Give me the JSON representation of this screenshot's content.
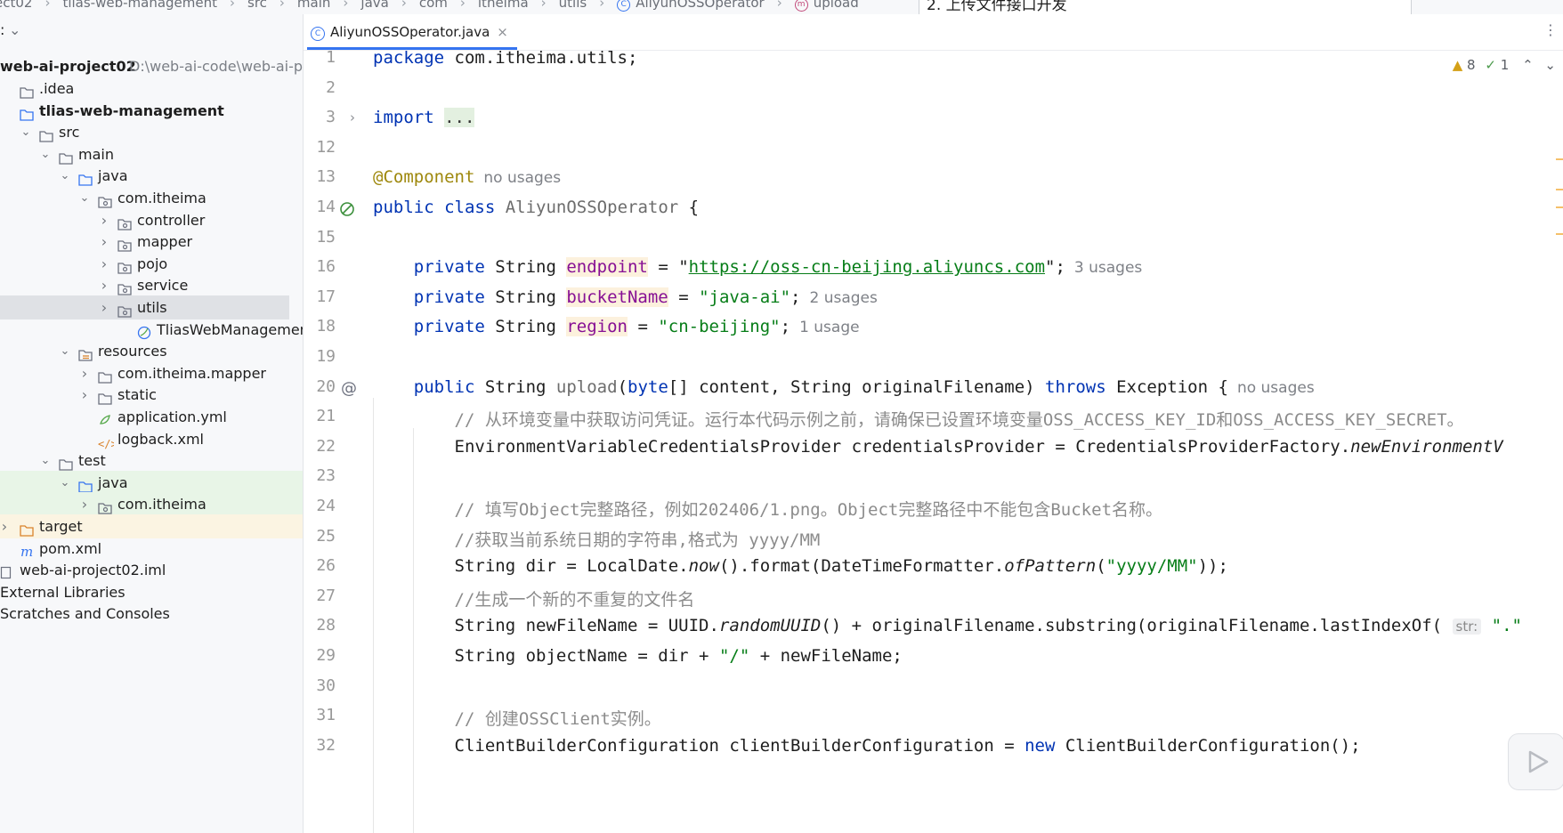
{
  "breadcrumbs": [
    "ect02",
    "tlias-web-management",
    "src",
    "main",
    "java",
    "com",
    "itheima",
    "utils",
    "AliyunOSSOperator",
    "upload"
  ],
  "tooltip": "2. 上传文件接口开发",
  "sidebar": {
    "header_label": ":",
    "project": {
      "name": "web-ai-project02",
      "path": "D:\\web-ai-code\\web-ai-p"
    },
    "tree": [
      {
        "label": ".idea",
        "indent": 0,
        "chev": "",
        "icon": "folder"
      },
      {
        "label": "tlias-web-management",
        "indent": 0,
        "chev": "",
        "icon": "module",
        "bold": true
      },
      {
        "label": "src",
        "indent": 1,
        "chev": "down",
        "icon": "folder"
      },
      {
        "label": "main",
        "indent": 2,
        "chev": "down",
        "icon": "folder"
      },
      {
        "label": "java",
        "indent": 3,
        "chev": "down",
        "icon": "srcfolder"
      },
      {
        "label": "com.itheima",
        "indent": 4,
        "chev": "down",
        "icon": "package"
      },
      {
        "label": "controller",
        "indent": 5,
        "chev": "right",
        "icon": "package"
      },
      {
        "label": "mapper",
        "indent": 5,
        "chev": "right",
        "icon": "package"
      },
      {
        "label": "pojo",
        "indent": 5,
        "chev": "right",
        "icon": "package"
      },
      {
        "label": "service",
        "indent": 5,
        "chev": "right",
        "icon": "package"
      },
      {
        "label": "utils",
        "indent": 5,
        "chev": "right",
        "icon": "package",
        "selected": true
      },
      {
        "label": "TliasWebManagementApplication",
        "indent": 6,
        "chev": "",
        "icon": "spring"
      },
      {
        "label": "resources",
        "indent": 3,
        "chev": "down",
        "icon": "resfolder"
      },
      {
        "label": "com.itheima.mapper",
        "indent": 4,
        "chev": "right",
        "icon": "folder"
      },
      {
        "label": "static",
        "indent": 4,
        "chev": "right",
        "icon": "folder"
      },
      {
        "label": "application.yml",
        "indent": 4,
        "chev": "",
        "icon": "yml"
      },
      {
        "label": "logback.xml",
        "indent": 4,
        "chev": "",
        "icon": "xml"
      },
      {
        "label": "test",
        "indent": 2,
        "chev": "down",
        "icon": "folder"
      },
      {
        "label": "java",
        "indent": 3,
        "chev": "down",
        "icon": "testfolder",
        "hl": "green"
      },
      {
        "label": "com.itheima",
        "indent": 4,
        "chev": "right",
        "icon": "package",
        "hl": "green"
      },
      {
        "label": "target",
        "indent": 0,
        "chev": "right",
        "icon": "orangefolder",
        "hl": "orange"
      },
      {
        "label": "pom.xml",
        "indent": 0,
        "chev": "",
        "icon": "maven"
      },
      {
        "label": "web-ai-project02.iml",
        "indent": -1,
        "chev": "",
        "icon": "iml"
      },
      {
        "label": "External Libraries",
        "indent": -2,
        "chev": "",
        "icon": ""
      },
      {
        "label": "Scratches and Consoles",
        "indent": -2,
        "chev": "",
        "icon": ""
      }
    ]
  },
  "editor": {
    "tab_name": "AliyunOSSOperator.java",
    "inspection": {
      "warnings": "8",
      "checks": "1"
    },
    "lines": [
      {
        "n": "1",
        "tokens": [
          [
            "kw",
            "package"
          ],
          [
            "",
            " com.itheima.utils;"
          ]
        ]
      },
      {
        "n": "2",
        "tokens": []
      },
      {
        "n": "3",
        "tokens": [
          [
            "kw",
            "import"
          ],
          [
            "",
            " "
          ],
          [
            "fold",
            "..."
          ]
        ]
      },
      {
        "n": "12",
        "tokens": []
      },
      {
        "n": "13",
        "tokens": [
          [
            "ann",
            "@Component"
          ],
          [
            "hint",
            "no usages"
          ]
        ]
      },
      {
        "n": "14",
        "tokens": [
          [
            "kw",
            "public class"
          ],
          [
            "",
            " "
          ],
          [
            "gray",
            "AliyunOSSOperator"
          ],
          [
            "",
            " {"
          ]
        ]
      },
      {
        "n": "15",
        "tokens": []
      },
      {
        "n": "16",
        "tokens": [
          [
            "",
            "    "
          ],
          [
            "kw",
            "private"
          ],
          [
            "",
            " String "
          ],
          [
            "fld",
            "endpoint"
          ],
          [
            "",
            " = \""
          ],
          [
            "link",
            "https://oss-cn-beijing.aliyuncs.com"
          ],
          [
            "",
            "\";"
          ],
          [
            "hint",
            "3 usages"
          ]
        ]
      },
      {
        "n": "17",
        "tokens": [
          [
            "",
            "    "
          ],
          [
            "kw",
            "private"
          ],
          [
            "",
            " String "
          ],
          [
            "fld",
            "bucketName"
          ],
          [
            "",
            " = "
          ],
          [
            "str",
            "\"java-ai\""
          ],
          [
            "",
            ";"
          ],
          [
            "hint",
            "2 usages"
          ]
        ]
      },
      {
        "n": "18",
        "tokens": [
          [
            "",
            "    "
          ],
          [
            "kw",
            "private"
          ],
          [
            "",
            " String "
          ],
          [
            "fld",
            "region"
          ],
          [
            "",
            " = "
          ],
          [
            "str",
            "\"cn-beijing\""
          ],
          [
            "",
            ";"
          ],
          [
            "hint",
            "1 usage"
          ]
        ]
      },
      {
        "n": "19",
        "tokens": []
      },
      {
        "n": "20",
        "tokens": [
          [
            "",
            "    "
          ],
          [
            "kw",
            "public"
          ],
          [
            "",
            " String "
          ],
          [
            "gray",
            "upload"
          ],
          [
            "",
            "("
          ],
          [
            "kw",
            "byte"
          ],
          [
            "",
            "[] content, String originalFilename) "
          ],
          [
            "kw",
            "throws"
          ],
          [
            "",
            " Exception {"
          ],
          [
            "hint",
            "no usages"
          ]
        ]
      },
      {
        "n": "21",
        "tokens": [
          [
            "",
            "        "
          ],
          [
            "cm",
            "// 从环境变量中获取访问凭证。运行本代码示例之前，请确保已设置环境变量OSS_ACCESS_KEY_ID和OSS_ACCESS_KEY_SECRET。"
          ]
        ]
      },
      {
        "n": "22",
        "tokens": [
          [
            "",
            "        EnvironmentVariableCredentialsProvider credentialsProvider = CredentialsProviderFactory."
          ],
          [
            "it",
            "newEnvironmentV"
          ]
        ]
      },
      {
        "n": "23",
        "tokens": []
      },
      {
        "n": "24",
        "tokens": [
          [
            "",
            "        "
          ],
          [
            "cm",
            "// 填写Object完整路径，例如202406/1.png。Object完整路径中不能包含Bucket名称。"
          ]
        ]
      },
      {
        "n": "25",
        "tokens": [
          [
            "",
            "        "
          ],
          [
            "cm",
            "//获取当前系统日期的字符串,格式为 yyyy/MM"
          ]
        ]
      },
      {
        "n": "26",
        "tokens": [
          [
            "",
            "        String dir = LocalDate."
          ],
          [
            "it",
            "now"
          ],
          [
            "",
            "().format(DateTimeFormatter."
          ],
          [
            "it",
            "ofPattern"
          ],
          [
            "",
            "("
          ],
          [
            "str",
            "\"yyyy/MM\""
          ],
          [
            "",
            "));"
          ]
        ]
      },
      {
        "n": "27",
        "tokens": [
          [
            "",
            "        "
          ],
          [
            "cm",
            "//生成一个新的不重复的文件名"
          ]
        ]
      },
      {
        "n": "28",
        "tokens": [
          [
            "",
            "        String newFileName = UUID."
          ],
          [
            "it",
            "randomUUID"
          ],
          [
            "",
            "() + originalFilename.substring(originalFilename.lastIndexOf( "
          ],
          [
            "phint",
            "str:"
          ],
          [
            "",
            " "
          ],
          [
            "str",
            "\".\""
          ]
        ]
      },
      {
        "n": "29",
        "tokens": [
          [
            "",
            "        String objectName = dir + "
          ],
          [
            "str",
            "\"/\""
          ],
          [
            "",
            " + newFileName;"
          ]
        ]
      },
      {
        "n": "30",
        "tokens": []
      },
      {
        "n": "31",
        "tokens": [
          [
            "",
            "        "
          ],
          [
            "cm",
            "// 创建OSSClient实例。"
          ]
        ]
      },
      {
        "n": "32",
        "tokens": [
          [
            "",
            "        ClientBuilderConfiguration clientBuilderConfiguration = "
          ],
          [
            "kw",
            "new"
          ],
          [
            "",
            " ClientBuilderConfiguration();"
          ]
        ]
      }
    ]
  }
}
